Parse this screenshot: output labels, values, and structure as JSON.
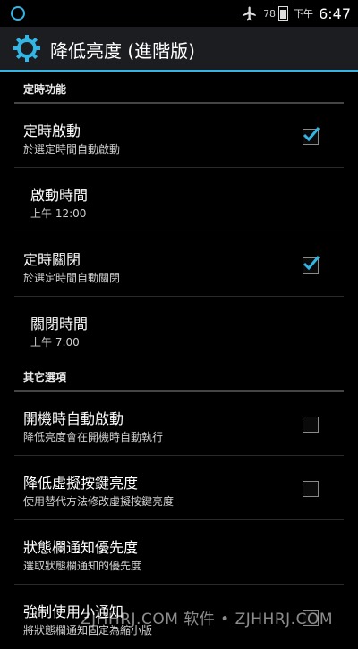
{
  "status_bar": {
    "battery_level": "78",
    "ampm": "下午",
    "time": "6:47"
  },
  "action_bar": {
    "title": "降低亮度 (進階版)"
  },
  "sections": [
    {
      "header": "定時功能",
      "items": [
        {
          "title": "定時啟動",
          "summary": "於選定時間自動啟動",
          "checked": true
        },
        {
          "title": "啟動時間",
          "summary": "上午 12:00"
        },
        {
          "title": "定時關閉",
          "summary": "於選定時間自動關閉",
          "checked": true
        },
        {
          "title": "關閉時間",
          "summary": "上午 7:00"
        }
      ]
    },
    {
      "header": "其它選項",
      "items": [
        {
          "title": "開機時自動啟動",
          "summary": "降低亮度會在開機時自動執行",
          "checked": false
        },
        {
          "title": "降低虛擬按鍵亮度",
          "summary": "使用替代方法修改虛擬按鍵亮度",
          "checked": false
        },
        {
          "title": "狀態欄通知優先度",
          "summary": "選取狀態欄通知的優先度"
        },
        {
          "title": "強制使用小通知",
          "summary": "將狀態欄通知固定為縮小版",
          "checked": false
        }
      ]
    }
  ],
  "watermark": "ZJHHRJ.COM 软件 • ZJHHRJ.COM",
  "colors": {
    "accent": "#33b5e5",
    "background": "#000000",
    "action_bar": "#1b1d20"
  },
  "icons": {
    "status_left": "notification-ring-icon",
    "airplane": "airplane-mode-icon",
    "battery": "battery-icon",
    "app": "gear-app-icon",
    "check": "checkmark-icon"
  }
}
